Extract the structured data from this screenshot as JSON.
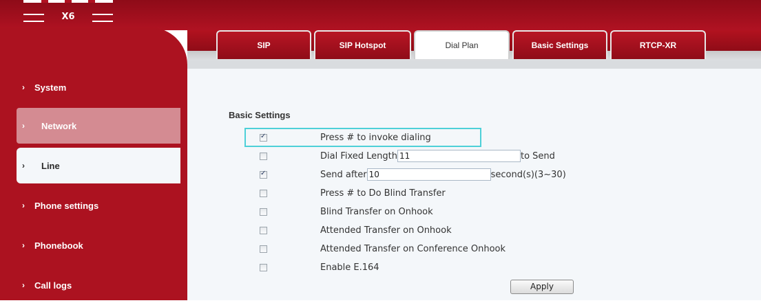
{
  "header": {
    "model": "X6"
  },
  "tabs": [
    {
      "label": "SIP",
      "active": false
    },
    {
      "label": "SIP Hotspot",
      "active": false
    },
    {
      "label": "Dial Plan",
      "active": true
    },
    {
      "label": "Basic Settings",
      "active": false
    },
    {
      "label": "RTCP-XR",
      "active": false
    }
  ],
  "sidebar": {
    "items": [
      {
        "label": "System"
      },
      {
        "label": "Network"
      },
      {
        "label": "Line"
      },
      {
        "label": "Phone settings"
      },
      {
        "label": "Phonebook"
      },
      {
        "label": "Call logs"
      }
    ]
  },
  "form": {
    "section_title": "Basic Settings",
    "press_hash": {
      "label": "Press # to invoke dialing",
      "checked": true
    },
    "dial_fixed_length": {
      "label": "Dial Fixed Length",
      "value": "11",
      "suffix": "to Send",
      "checked": false
    },
    "send_after": {
      "label": "Send after",
      "value": "10",
      "suffix": "second(s)(3~30)",
      "checked": true
    },
    "blind_transfer_hash": {
      "label": "Press # to Do Blind Transfer",
      "checked": false
    },
    "blind_transfer_onhook": {
      "label": "Blind Transfer on Onhook",
      "checked": false
    },
    "attended_transfer_onhook": {
      "label": "Attended Transfer on Onhook",
      "checked": false
    },
    "attended_transfer_conference": {
      "label": "Attended Transfer on Conference Onhook",
      "checked": false
    },
    "enable_e164": {
      "label": "Enable E.164",
      "checked": false
    },
    "apply_label": "Apply"
  },
  "colors": {
    "brand_red": "#ac1220",
    "highlight": "#4dd0d8",
    "content_bg": "#f4f7fa"
  }
}
